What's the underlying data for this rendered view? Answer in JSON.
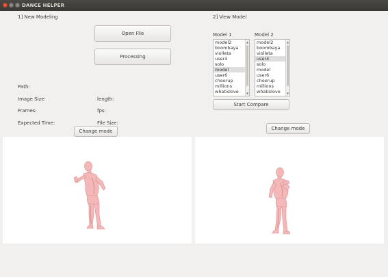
{
  "window": {
    "title": "DANCE HELPER"
  },
  "left_panel": {
    "heading": "1] New Modeling",
    "open_file_label": "Open File",
    "processing_label": "Processing",
    "path_label": "Path:",
    "image_size_label": "Image Size:",
    "length_label": "length:",
    "frames_label": "Frames:",
    "fps_label": "fps:",
    "expected_time_label": "Expected Time:",
    "file_size_label": "File Size:",
    "change_mode_label": "Change mode"
  },
  "right_panel": {
    "heading": "2] View Model",
    "model1_label": "Model 1",
    "model2_label": "Model 2",
    "model1_items": [
      "model2",
      "boombaya",
      "violleta",
      "user4",
      "solo",
      "model",
      "user6",
      "cheerup",
      "millions",
      "whatislove"
    ],
    "model1_selected": "model",
    "model2_items": [
      "model2",
      "boombaya",
      "violleta",
      "user4",
      "solo",
      "model",
      "user6",
      "cheerup",
      "millions",
      "whatislove"
    ],
    "model2_selected": "user4",
    "start_compare_label": "Start Compare",
    "change_mode_label": "Change mode"
  },
  "colors": {
    "figure_fill": "#f4b8b8",
    "figure_shade": "#d58f90",
    "viewport_bg": "#ffffff",
    "window_bg": "#f1f0ef"
  }
}
